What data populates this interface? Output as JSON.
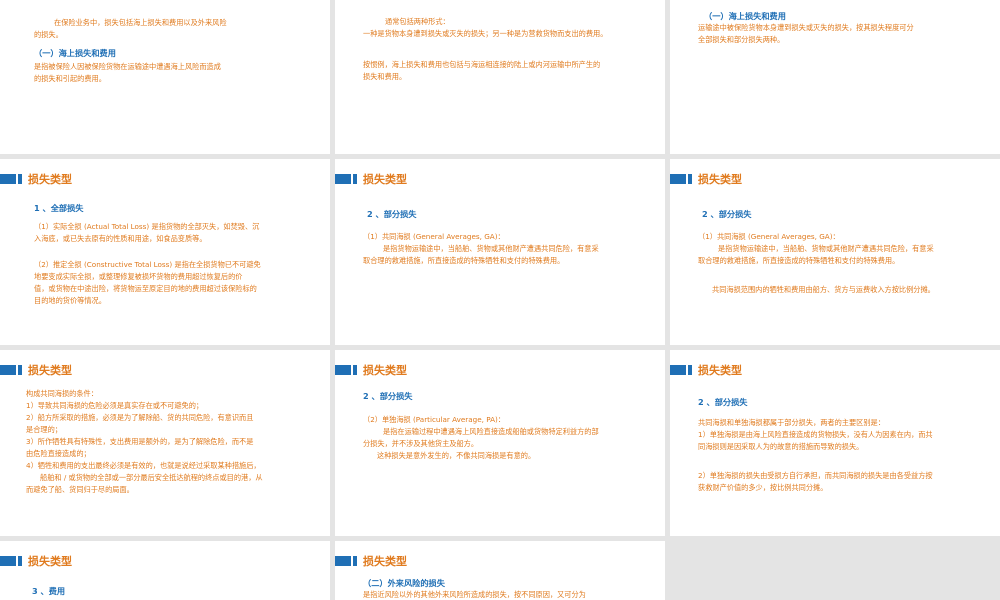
{
  "slides": [
    {
      "lines_a": [
        "在保险业务中，损失包括海上损失和费用以及外来风险",
        "的损失。"
      ],
      "subtitle": "（一）海上损失和费用",
      "lines_b": [
        "是指被保险人因被保险货物在运输途中遭遇海上风险而造成",
        "的损失和引起的费用。"
      ]
    },
    {
      "lines_a": [
        "通常包括两种形式：",
        "一种是货物本身遭到损失或灭失的损失；另一种是为营救货物而支出的费用。"
      ],
      "lines_b": [
        "按惯例，海上损失和费用也包括与海运相连接的陆上或内河运输中所产生的",
        "损失和费用。"
      ]
    },
    {
      "subtitle": "（一）海上损失和费用",
      "lines_a": [
        "运输途中被保险货物本身遭到损失或灭失的损失，按其损失程度可分",
        "全部损失和部分损失两种。"
      ]
    },
    {
      "title": "损失类型",
      "subtitle": "1 、全部损失",
      "lines_a": [
        "（1）实际全损 (Actual Total Loss) 是指货物的全部灭失，如焚毁、沉",
        "入海底，或已失去原有的性质和用途，如食品变质等。"
      ],
      "lines_b": [
        "（2）推定全损 (Constructive Total Loss) 是指在全损货物已不可避免",
        "地要变成实际全损，或整理修复被损坏货物的费用超过恢复后的价",
        "值，或货物在中途出险，将货物运至原定目的地的费用超过该保险标的",
        "目的地的货价等情况。"
      ]
    },
    {
      "title": "损失类型",
      "subtitle": "2 、部分损失",
      "lines_a": [
        "（1）共同海损 (General Averages, GA)：",
        "是指货物运输途中，当船舶、货物或其他财产遭遇共同危险，有意采",
        "取合理的救难措施，所直接造成的特殊牺牲和支付的特殊费用。"
      ]
    },
    {
      "title": "损失类型",
      "subtitle": "2 、部分损失",
      "lines_a": [
        "（1）共同海损 (General Averages, GA)：",
        "是指货物运输途中，当船舶、货物或其他财产遭遇共同危险，有意采",
        "取合理的救难措施，所直接造成的特殊牺牲和支付的特殊费用。"
      ],
      "lines_b": [
        "共同海损范围内的牺牲和费用由船方、货方与运费收入方按比例分摊。"
      ]
    },
    {
      "title": "损失类型",
      "lines_a": [
        "构成共同海损的条件：",
        "1）导致共同海损的危险必须是真实存在或不可避免的；",
        "2）船方所采取的措施，必须是为了解除船、货的共同危险，有意识而且",
        "是合理的；",
        "3）所作牺牲具有特殊性，支出费用是额外的，是为了解除危险，而不是",
        "由危险直接造成的；",
        "4）牺牲和费用的支出最终必须是有效的，也就是说经过采取某种措施后，",
        "船舶和 / 或货物的全部或一部分最后安全抵达航程的终点或目的港，从",
        "而避免了船、货同归于尽的局面。"
      ]
    },
    {
      "title": "损失类型",
      "subtitle": "2 、部分损失",
      "lines_a": [
        "（2）单独海损 (Particular Average, PA)：",
        "是指在运输过程中遭遇海上风险直接造成船舶或货物特定利益方的部",
        "分损失，并不涉及其他货主及船方。",
        "这种损失是意外发生的，不像共同海损是有意的。"
      ]
    },
    {
      "title": "损失类型",
      "subtitle": "2 、部分损失",
      "lines_a": [
        "共同海损和单独海损都属于部分损失，两者的主要区别是：",
        "1）单独海损是由海上风险直接造成的货物损失，没有人为因素在内，而共",
        "同海损则是因采取人为的故意的措施而导致的损失。"
      ],
      "lines_b": [
        "2）单独海损的损失由受损方自行承担，而共同海损的损失是由各受益方按",
        "获救财产价值的多少，按比例共同分摊。"
      ]
    },
    {
      "title": "损失类型",
      "subtitle": "3 、费用"
    },
    {
      "title": "损失类型",
      "subtitle": "（二）外来风险的损失",
      "lines_a": [
        "是指近风险以外的其他外来风险所造成的损失，按不同原因，又可分为"
      ]
    }
  ]
}
